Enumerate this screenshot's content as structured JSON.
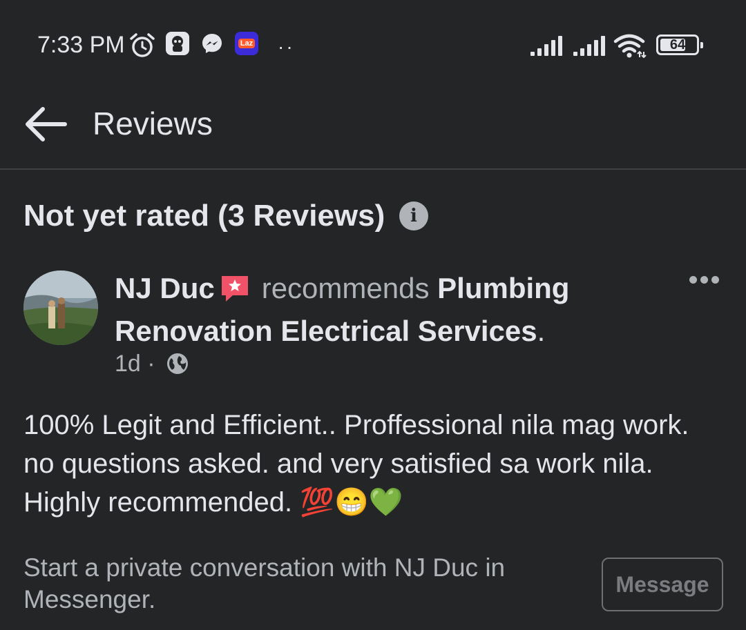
{
  "status_bar": {
    "time": "7:33 PM",
    "dots": "··",
    "battery_level": "64",
    "icons": [
      "alarm-icon",
      "app-icon",
      "messenger-icon",
      "lazada-icon",
      "signal-icon",
      "signal-icon",
      "wifi-icon",
      "battery-icon"
    ],
    "laz_label": "Laz"
  },
  "header": {
    "title": "Reviews"
  },
  "summary": {
    "text": "Not yet rated (3 Reviews)",
    "info_icon": "i"
  },
  "review": {
    "reviewer": "NJ Duc",
    "action": "recommends",
    "page_name": "Plumbing Renovation Electrical Services",
    "period": ".",
    "time": "1d",
    "separator": "·",
    "body": "100% Legit and Efficient.. Proffessional nila mag work. no questions asked. and very satisfied sa work nila. Highly recommended. 💯😁💚"
  },
  "footer": {
    "prompt": "Start a private conversation with NJ Duc in Messenger.",
    "message_label": "Message"
  },
  "colors": {
    "background": "#242526",
    "text": "#e4e6eb",
    "secondary": "#b0b3b8",
    "badge": "#f25268"
  }
}
